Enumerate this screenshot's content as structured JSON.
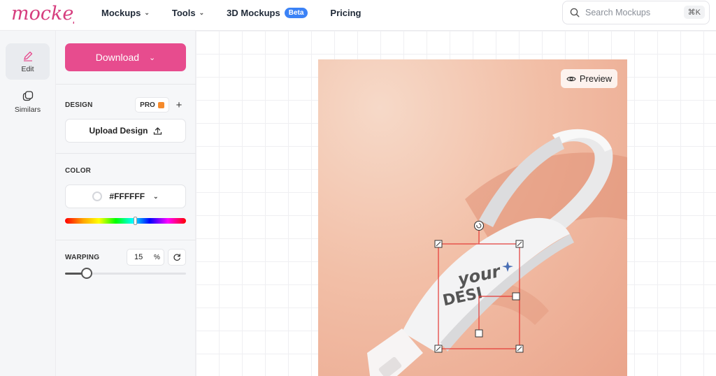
{
  "app": {
    "logo_text": "mockey"
  },
  "nav": {
    "items": [
      {
        "label": "Mockups",
        "has_dropdown": true
      },
      {
        "label": "Tools",
        "has_dropdown": true
      },
      {
        "label": "3D Mockups",
        "badge": "Beta"
      },
      {
        "label": "Pricing"
      }
    ]
  },
  "search": {
    "placeholder": "Search Mockups",
    "shortcut": "⌘K"
  },
  "rail": {
    "items": [
      {
        "label": "Edit",
        "icon": "pencil-icon",
        "active": true
      },
      {
        "label": "Similars",
        "icon": "similars-icon"
      }
    ]
  },
  "panel": {
    "download_label": "Download",
    "design": {
      "label": "DESIGN",
      "pro_label": "PRO",
      "upload_label": "Upload Design"
    },
    "color": {
      "label": "COLOR",
      "value": "#FFFFFF",
      "hue_position": 0.58
    },
    "warping": {
      "label": "WARPING",
      "value": "15",
      "unit": "%",
      "slider_fraction": 0.18
    }
  },
  "canvas": {
    "preview_label": "Preview",
    "design_text_line1": "your",
    "design_text_line2": "DESI"
  },
  "colors": {
    "brand_pink": "#e74c8e",
    "beta_blue": "#3b82f6",
    "selection_red": "#e53935",
    "background_peach": "#f2bfa7"
  }
}
